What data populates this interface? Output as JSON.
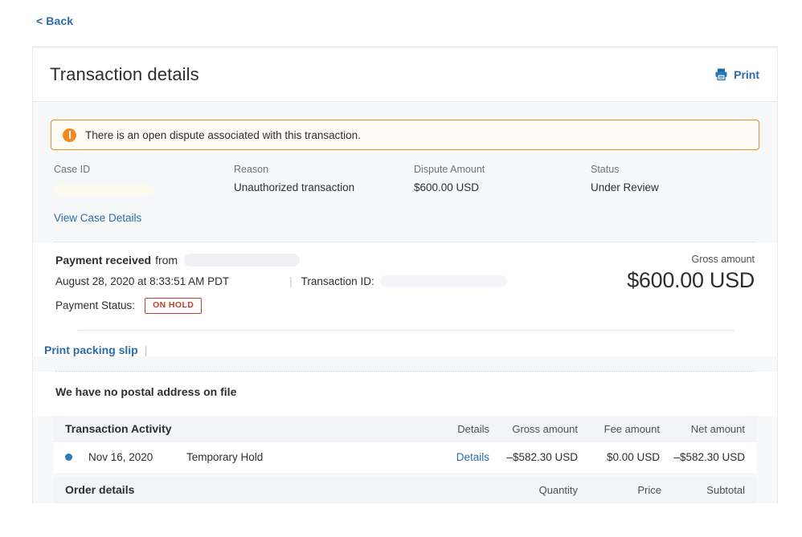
{
  "nav": {
    "back_label": "< Back"
  },
  "card": {
    "title": "Transaction details",
    "print_label": "Print",
    "print_icon": "printer-icon"
  },
  "alert": {
    "icon": "warning-exclamation-icon",
    "message": "There is an open dispute associated with this transaction."
  },
  "dispute": {
    "labels": {
      "case_id": "Case ID",
      "reason": "Reason",
      "amount": "Dispute Amount",
      "status": "Status"
    },
    "values": {
      "case_id": "",
      "reason": "Unauthorized transaction",
      "amount": "$600.00 USD",
      "status": "Under Review"
    },
    "view_case_link": "View Case Details"
  },
  "payment": {
    "received_strong": "Payment received",
    "received_from": "from",
    "payer": "",
    "datetime": "August 28, 2020 at 8:33:51 AM PDT",
    "separator": "|",
    "transaction_id_label": "Transaction ID:",
    "transaction_id": "",
    "status_label": "Payment Status:",
    "status_badge": "ON HOLD",
    "gross_label": "Gross amount",
    "gross_amount": "$600.00 USD"
  },
  "packing": {
    "link": "Print packing slip",
    "separator": "|",
    "no_address": "We have no postal address on file"
  },
  "activity": {
    "title": "Transaction Activity",
    "columns": {
      "details": "Details",
      "gross": "Gross amount",
      "fee": "Fee amount",
      "net": "Net amount"
    },
    "rows": [
      {
        "date": "Nov 16, 2020",
        "description": "Temporary Hold",
        "details_link": "Details",
        "gross": "–$582.30 USD",
        "fee": "$0.00 USD",
        "net": "–$582.30 USD"
      }
    ]
  },
  "order": {
    "title": "Order details",
    "columns": {
      "quantity": "Quantity",
      "price": "Price",
      "subtotal": "Subtotal"
    }
  },
  "colors": {
    "link_blue": "#2c6bac",
    "alert_orange": "#e98b2e",
    "badge_red": "#c0412b",
    "dot_blue": "#2b7cb9"
  }
}
